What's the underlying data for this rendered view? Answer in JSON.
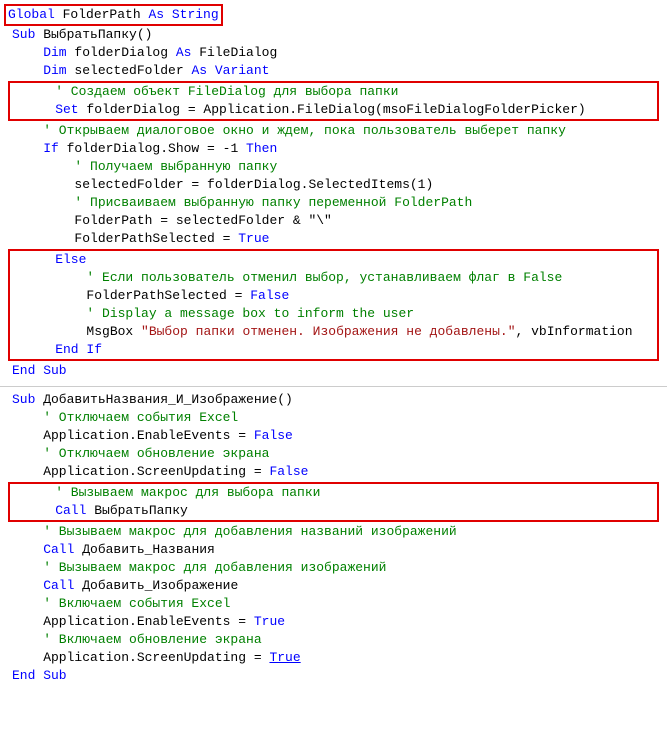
{
  "code": {
    "l1_global": "Global",
    "l1_var": " FolderPath ",
    "l1_as": "As ",
    "l1_type": "String",
    "blank": "",
    "l3_sub": "Sub",
    "l3_name": " ВыбратьПапку()",
    "l4_dim": "    Dim",
    "l4_var": " folderDialog ",
    "l4_as": "As",
    "l4_type": " FileDialog",
    "l5_dim": "    Dim",
    "l5_var": " selectedFolder ",
    "l5_as": "As Variant",
    "l7_comment": "    ' Создаем объект FileDialog для выбора папки",
    "l8_set": "    Set",
    "l8_rest": " folderDialog = Application.FileDialog(msoFileDialogFolderPicker)",
    "l10_comment": "    ' Открываем диалоговое окно и ждем, пока пользователь выберет папку",
    "l11_if": "    If",
    "l11_cond": " folderDialog.Show = -1 ",
    "l11_then": "Then",
    "l12_comment": "        ' Получаем выбранную папку",
    "l13": "        selectedFolder = folderDialog.SelectedItems(1)",
    "l15_comment": "        ' Присваиваем выбранную папку переменной FolderPath",
    "l16": "        FolderPath = selectedFolder & \"\\\"",
    "l17a": "        FolderPathSelected = ",
    "l17b": "True",
    "l18_else": "    Else",
    "l19_comment": "        ' Если пользователь отменил выбор, устанавливаем флаг в False",
    "l20a": "        FolderPathSelected = ",
    "l20b": "False",
    "l21_comment": "        ' Display a message box to inform the user",
    "l22a": "        MsgBox ",
    "l22b": "\"Выбор папки отменен. Изображения не добавлены.\"",
    "l22c": ", vbInformation",
    "l23_endif": "    End If",
    "l24_endsub": "End Sub",
    "l26_sub": "Sub",
    "l26_name": " ДобавитьНазвания_И_Изображение()",
    "l27_comment": "    ' Отключаем события Excel",
    "l28a": "    Application.EnableEvents = ",
    "l28b": "False",
    "l30_comment": "    ' Отключаем обновление экрана",
    "l31a": "    Application.ScreenUpdating = ",
    "l31b": "False",
    "l33_comment": "    ' Вызываем макрос для выбора папки",
    "l34_call": "    Call",
    "l34_name": " ВыбратьПапку",
    "l36_comment": "    ' Вызываем макрос для добавления названий изображений",
    "l37_call": "    Call",
    "l37_name": " Добавить_Названия",
    "l39_comment": "    ' Вызываем макрос для добавления изображений",
    "l40_call": "    Call",
    "l40_name": " Добавить_Изображение",
    "l42_comment": "    ' Включаем события Excel",
    "l43a": "    Application.EnableEvents = ",
    "l43b": "True",
    "l45_comment": "    ' Включаем обновление экрана",
    "l46a": "    Application.ScreenUpdating = ",
    "l46b": "True",
    "l47_endsub": "End Sub"
  }
}
